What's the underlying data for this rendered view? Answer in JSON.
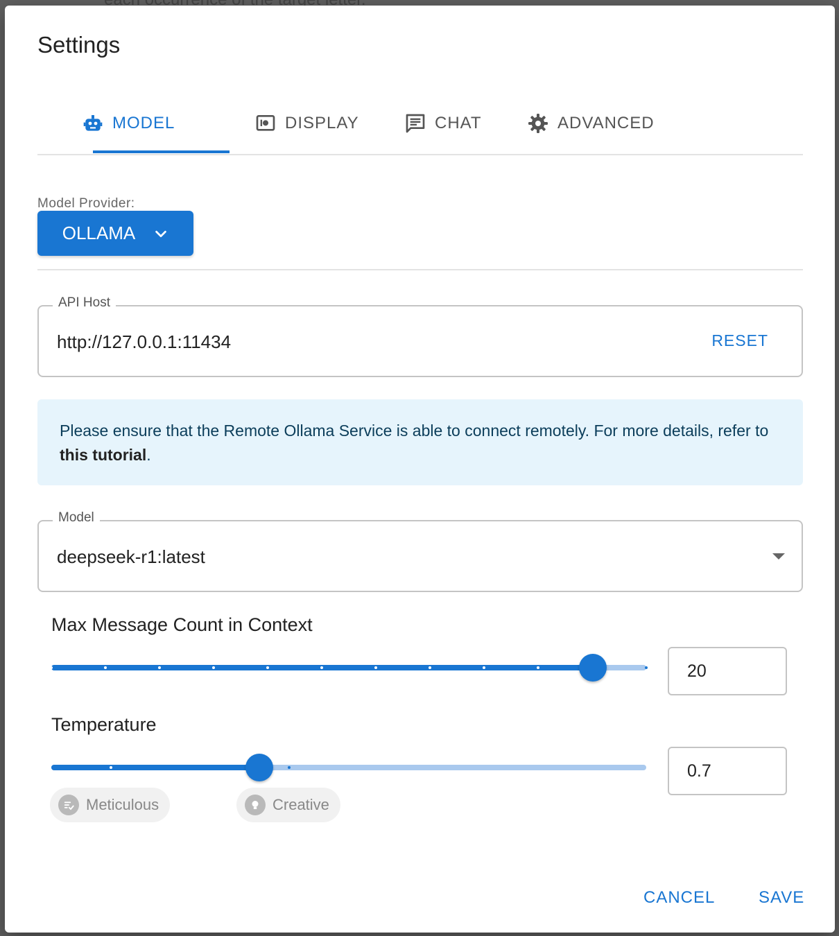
{
  "backdrop": {
    "text": "each occurrence of the target letter."
  },
  "dialog": {
    "title": "Settings",
    "tabs": [
      {
        "label": "MODEL",
        "icon": "robot-icon",
        "active": true
      },
      {
        "label": "DISPLAY",
        "icon": "display-settings-icon",
        "active": false
      },
      {
        "label": "CHAT",
        "icon": "chat-icon",
        "active": false
      },
      {
        "label": "ADVANCED",
        "icon": "gear-icon",
        "active": false
      }
    ],
    "model_provider": {
      "label": "Model Provider:",
      "value": "OLLAMA"
    },
    "api_host": {
      "legend": "API Host",
      "value": "http://127.0.0.1:11434",
      "reset_label": "RESET"
    },
    "info": {
      "text_before": "Please ensure that the Remote Ollama Service is able to connect remotely. For more details, refer to ",
      "link_text": "this tutorial",
      "text_after": "."
    },
    "model": {
      "legend": "Model",
      "value": "deepseek-r1:latest"
    },
    "max_messages": {
      "title": "Max Message Count in Context",
      "value": "20",
      "slider_fraction": 0.91
    },
    "temperature": {
      "title": "Temperature",
      "value": "0.7",
      "slider_fraction": 0.35,
      "chips": [
        {
          "label": "Meticulous"
        },
        {
          "label": "Creative"
        }
      ]
    },
    "footer": {
      "cancel_label": "CANCEL",
      "save_label": "SAVE"
    },
    "colors": {
      "accent": "#1976d2",
      "rail": "#a9c9ee",
      "info_bg": "#e6f4fc"
    }
  }
}
